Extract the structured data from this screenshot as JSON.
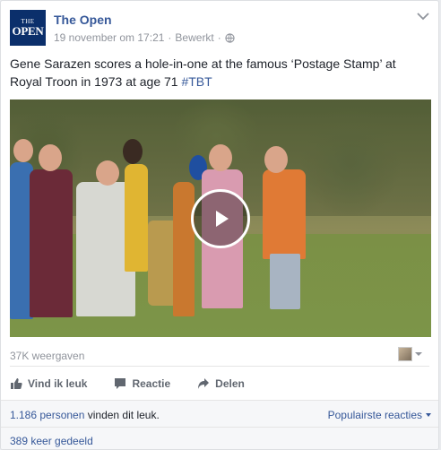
{
  "post": {
    "page_name": "The Open",
    "logo_top": "THE",
    "logo_bottom": "OPEN",
    "date": "19 november om 17:21",
    "separator": "·",
    "edited": "Bewerkt",
    "separator2": "·",
    "text": "Gene Sarazen scores a hole-in-one at the famous ‘Postage Stamp’ at Royal Troon in 1973 at age 71 ",
    "hashtag": "#TBT"
  },
  "video": {
    "views": "37K weergaven",
    "play_icon": "play-icon"
  },
  "actions": {
    "like": "Vind ik leuk",
    "comment": "Reactie",
    "share": "Delen"
  },
  "footer": {
    "likes_count": "1.186 personen",
    "likes_suffix": " vinden dit leuk.",
    "popular": "Populairste reacties",
    "shares": "389 keer gedeeld"
  },
  "colors": {
    "link": "#365899",
    "muted": "#90949c",
    "logo_bg": "#0b2f6b"
  }
}
